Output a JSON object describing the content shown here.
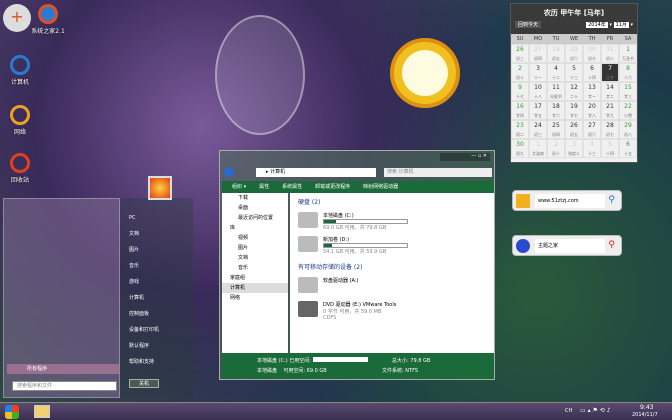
{
  "desktop_icons": [
    {
      "label": "系统之家2.1"
    },
    {
      "label": "计算机"
    },
    {
      "label": "网络"
    },
    {
      "label": "回收站"
    }
  ],
  "start_menu": {
    "right_items": [
      "PC",
      "文档",
      "图片",
      "音乐",
      "游戏",
      "计算机",
      "控制面板",
      "设备和打印机",
      "默认程序",
      "帮助和支持"
    ],
    "all_programs": "所有程序",
    "search_placeholder": "搜索程序和文件",
    "shutdown": "关机"
  },
  "explorer": {
    "address": "计算机",
    "search_placeholder": "搜索 计算机",
    "toolbar": [
      "组织 ▾",
      "属性",
      "系统属性",
      "卸载或更改程序",
      "映射网络驱动器"
    ],
    "nav": [
      "下载",
      "桌面",
      "最近访问的位置",
      "库",
      "视频",
      "图片",
      "文档",
      "音乐",
      "家庭组",
      "计算机",
      "网络"
    ],
    "groups": [
      {
        "title": "硬盘 (2)",
        "items": [
          {
            "name": "本地磁盘 (C:)",
            "info": "69.0 GB 可用，共 79.8 GB",
            "used": 0.14
          },
          {
            "name": "新加卷 (D:)",
            "info": "54.1 GB 可用，共 59.9 GB",
            "used": 0.1
          }
        ]
      },
      {
        "title": "有可移动存储的设备 (2)",
        "items": [
          {
            "name": "软盘驱动器 (A:)"
          },
          {
            "name": "DVD 驱动器 (E:) VMware Tools",
            "info": "0 字节 可用，共 59.0 MB",
            "extra": "CDFS"
          }
        ]
      }
    ],
    "status": {
      "name": "本地磁盘 (C:)",
      "type": "本地磁盘",
      "used_label": "已用空间:",
      "free_label": "可用空间:",
      "free": "69.0 GB",
      "total_label": "总大小:",
      "total": "79.8 GB",
      "fs_label": "文件系统:",
      "fs": "NTFS"
    }
  },
  "calendar": {
    "title": "农历 甲午年 [马年]",
    "today_btn": "回到今天",
    "year": "2014年",
    "month": "11月",
    "weekdays": [
      "SU",
      "MO",
      "TU",
      "WE",
      "TH",
      "FR",
      "SA"
    ],
    "days": [
      [
        "26",
        "初三"
      ],
      [
        "27",
        "初四"
      ],
      [
        "28",
        "初五"
      ],
      [
        "29",
        "初六"
      ],
      [
        "30",
        "初七"
      ],
      [
        "31",
        "初八"
      ],
      [
        "1",
        "万圣节"
      ],
      [
        "2",
        "初十"
      ],
      [
        "3",
        "十一"
      ],
      [
        "4",
        "十二"
      ],
      [
        "5",
        "十三"
      ],
      [
        "6",
        "十四"
      ],
      [
        "7",
        "立冬"
      ],
      [
        "8",
        "十六"
      ],
      [
        "9",
        "十七"
      ],
      [
        "10",
        "十八"
      ],
      [
        "11",
        "光棍节"
      ],
      [
        "12",
        "二十"
      ],
      [
        "13",
        "廿一"
      ],
      [
        "14",
        "廿二"
      ],
      [
        "15",
        "廿三"
      ],
      [
        "16",
        "廿四"
      ],
      [
        "17",
        "廿五"
      ],
      [
        "18",
        "廿六"
      ],
      [
        "19",
        "廿七"
      ],
      [
        "20",
        "廿八"
      ],
      [
        "21",
        "廿九"
      ],
      [
        "22",
        "小雪"
      ],
      [
        "23",
        "初二"
      ],
      [
        "24",
        "初三"
      ],
      [
        "25",
        "初四"
      ],
      [
        "26",
        "初五"
      ],
      [
        "27",
        "初六"
      ],
      [
        "28",
        "初七"
      ],
      [
        "29",
        "初八"
      ],
      [
        "30",
        "初九"
      ],
      [
        "1",
        "艾滋病"
      ],
      [
        "2",
        "初十"
      ],
      [
        "3",
        "残疾人"
      ],
      [
        "4",
        "十三"
      ],
      [
        "5",
        "十四"
      ],
      [
        "6",
        "十五"
      ]
    ]
  },
  "search_widgets": [
    {
      "value": "www.51ztzj.com"
    },
    {
      "value": "主题之家"
    }
  ],
  "taskbar": {
    "time": "9:43",
    "date": "2014/11/7",
    "lang": "CH"
  }
}
